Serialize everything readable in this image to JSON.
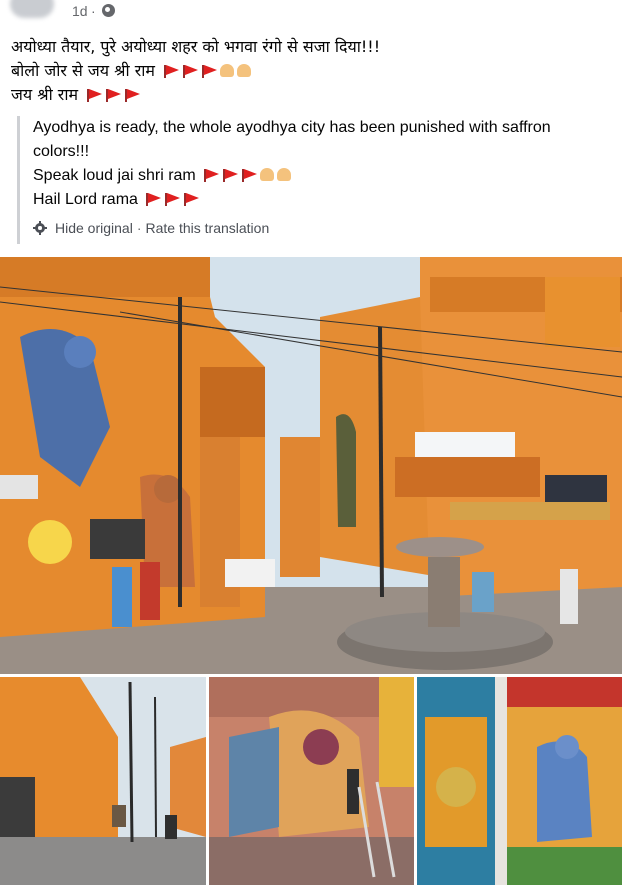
{
  "post": {
    "timestamp": "1d",
    "separator": "·",
    "privacy_icon": "globe-icon",
    "original_lines": [
      "अयोध्या तैयार, पुरे अयोध्या शहर को भगवा रंगो से सजा दिया!!!",
      "बोलो जोर से जय श्री राम",
      "जय श्री राम"
    ],
    "translation_lines": [
      "Ayodhya is ready, the whole ayodhya city has been punished with saffron",
      "colors!!!",
      "Speak loud jai shri ram",
      "Hail Lord rama"
    ],
    "hide_original_label": "Hide original",
    "action_separator": "·",
    "rate_translation_label": "Rate this translation",
    "gear_icon": "gear-icon",
    "emoji": {
      "flag": "triangular-flag-icon",
      "hands": "folded-hands-icon"
    }
  },
  "colors": {
    "saffron": "#e8892a",
    "sky": "#cfe0ea",
    "link_gray": "#65676b",
    "border": "#ced0d4"
  }
}
